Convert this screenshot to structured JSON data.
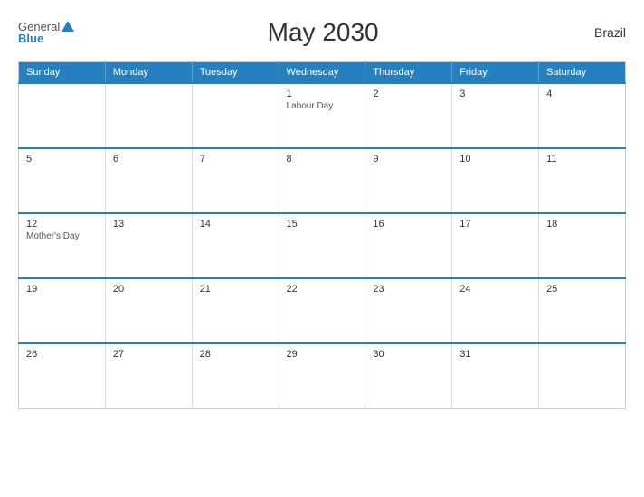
{
  "header": {
    "logo_general": "General",
    "logo_blue": "Blue",
    "title": "May 2030",
    "country": "Brazil"
  },
  "calendar": {
    "days_of_week": [
      "Sunday",
      "Monday",
      "Tuesday",
      "Wednesday",
      "Thursday",
      "Friday",
      "Saturday"
    ],
    "weeks": [
      [
        {
          "day": "",
          "holiday": ""
        },
        {
          "day": "",
          "holiday": ""
        },
        {
          "day": "",
          "holiday": ""
        },
        {
          "day": "1",
          "holiday": "Labour Day"
        },
        {
          "day": "2",
          "holiday": ""
        },
        {
          "day": "3",
          "holiday": ""
        },
        {
          "day": "4",
          "holiday": ""
        }
      ],
      [
        {
          "day": "5",
          "holiday": ""
        },
        {
          "day": "6",
          "holiday": ""
        },
        {
          "day": "7",
          "holiday": ""
        },
        {
          "day": "8",
          "holiday": ""
        },
        {
          "day": "9",
          "holiday": ""
        },
        {
          "day": "10",
          "holiday": ""
        },
        {
          "day": "11",
          "holiday": ""
        }
      ],
      [
        {
          "day": "12",
          "holiday": "Mother's Day"
        },
        {
          "day": "13",
          "holiday": ""
        },
        {
          "day": "14",
          "holiday": ""
        },
        {
          "day": "15",
          "holiday": ""
        },
        {
          "day": "16",
          "holiday": ""
        },
        {
          "day": "17",
          "holiday": ""
        },
        {
          "day": "18",
          "holiday": ""
        }
      ],
      [
        {
          "day": "19",
          "holiday": ""
        },
        {
          "day": "20",
          "holiday": ""
        },
        {
          "day": "21",
          "holiday": ""
        },
        {
          "day": "22",
          "holiday": ""
        },
        {
          "day": "23",
          "holiday": ""
        },
        {
          "day": "24",
          "holiday": ""
        },
        {
          "day": "25",
          "holiday": ""
        }
      ],
      [
        {
          "day": "26",
          "holiday": ""
        },
        {
          "day": "27",
          "holiday": ""
        },
        {
          "day": "28",
          "holiday": ""
        },
        {
          "day": "29",
          "holiday": ""
        },
        {
          "day": "30",
          "holiday": ""
        },
        {
          "day": "31",
          "holiday": ""
        },
        {
          "day": "",
          "holiday": ""
        }
      ]
    ]
  }
}
